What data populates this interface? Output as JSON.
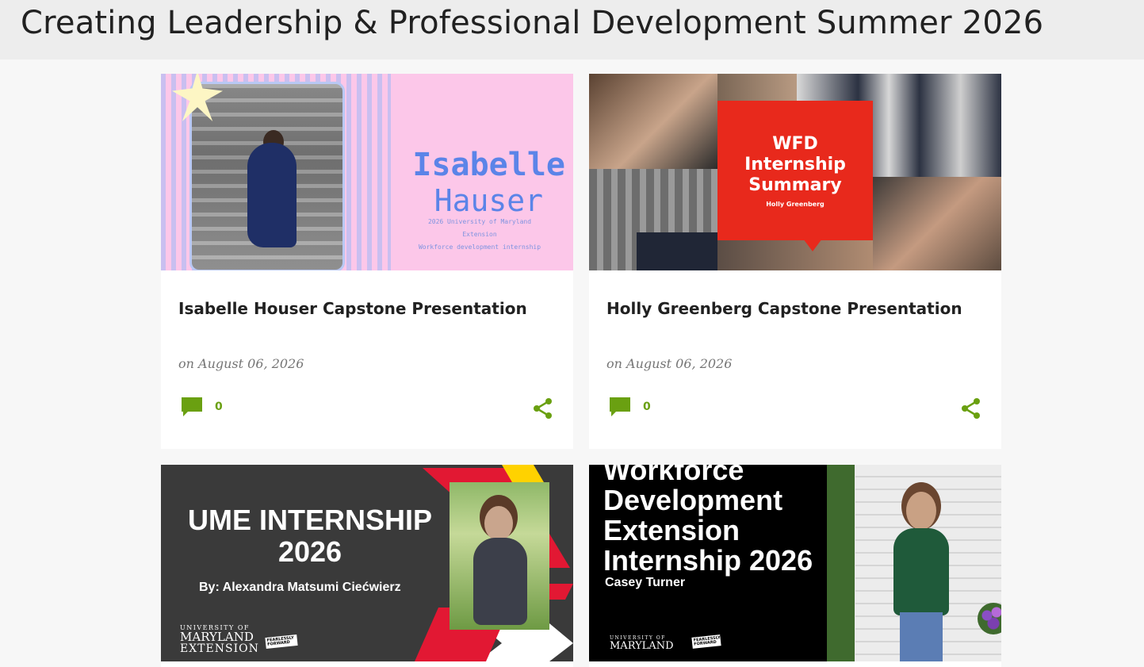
{
  "page": {
    "title": "Creating Leadership & Professional Development Summer 2026"
  },
  "colors": {
    "accent_green": "#6aa011",
    "header_bg": "#ededed",
    "page_bg": "#f7f7f7",
    "card_bg": "#ffffff"
  },
  "posts": [
    {
      "title": "Isabelle Houser Capstone Presentation",
      "date": "on August 06, 2026",
      "comment_count": "0",
      "thumbnail": {
        "name_line1": "Isabelle",
        "name_line2": "Hauser",
        "sub_line1": "2026 University of Maryland",
        "sub_line2": "Extension",
        "sub_line3": "Workforce development internship"
      }
    },
    {
      "title": "Holly Greenberg Capstone Presentation",
      "date": "on August 06, 2026",
      "comment_count": "0",
      "thumbnail": {
        "line1": "WFD",
        "line2": "Internship",
        "line3": "Summary",
        "name": "Holly Greenberg"
      }
    },
    {
      "thumbnail": {
        "line1": "UME INTERNSHIP",
        "line2": "2026",
        "byline": "By: Alexandra Matsumi Ciećwierz",
        "logo_top": "UNIVERSITY OF",
        "logo_mid": "MARYLAND",
        "logo_bottom": "EXTENSION",
        "badge": "FEARLESSLY FORWARD"
      }
    },
    {
      "thumbnail": {
        "line0": "Workforce",
        "line1": "Development",
        "line2": "Extension",
        "line3": "Internship 2026",
        "name": "Casey Turner",
        "logo_top": "UNIVERSITY OF",
        "logo_mid": "MARYLAND",
        "badge": "FEARLESSLY FORWARD"
      }
    }
  ]
}
